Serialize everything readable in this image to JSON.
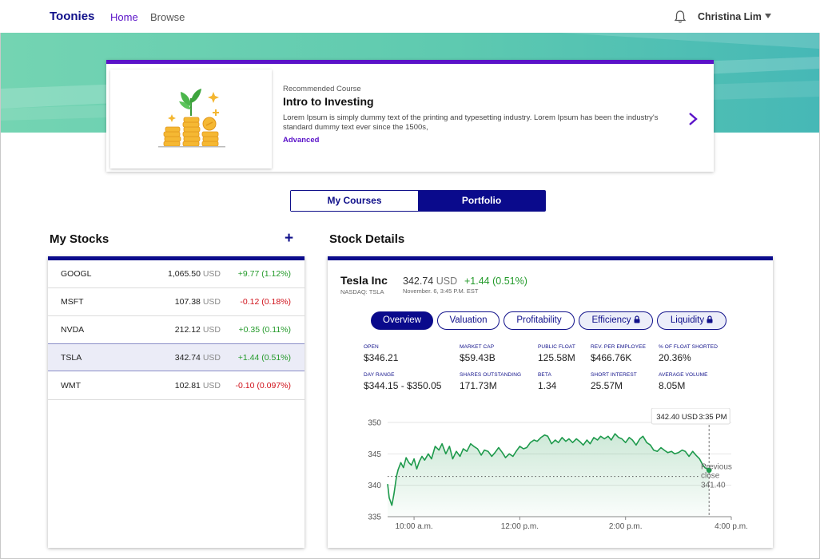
{
  "nav": {
    "brand": "Toonies",
    "home": "Home",
    "browse": "Browse",
    "user_name": "Christina Lim",
    "icons": {
      "bell": "bell-icon",
      "caret": "caret-down-icon"
    }
  },
  "course": {
    "kicker": "Recommended Course",
    "title": "Intro to Investing",
    "description": "Lorem Ipsum is simply dummy text of the printing and typesetting industry. Lorem Ipsum has been the industry's standard dummy text ever since the 1500s,",
    "level": "Advanced",
    "next_icon": "chevron-right-icon"
  },
  "toggle": {
    "my_courses": "My Courses",
    "portfolio": "Portfolio",
    "active": "Portfolio"
  },
  "my_stocks": {
    "title": "My Stocks",
    "add_label": "+",
    "rows": [
      {
        "symbol": "GOOGL",
        "price": "1,065.50",
        "unit": "USD",
        "change": "+9.77 (1.12%)",
        "direction": "up"
      },
      {
        "symbol": "MSFT",
        "price": "107.38",
        "unit": "USD",
        "change": "-0.12 (0.18%)",
        "direction": "down"
      },
      {
        "symbol": "NVDA",
        "price": "212.12",
        "unit": "USD",
        "change": "+0.35 (0.11%)",
        "direction": "up"
      },
      {
        "symbol": "TSLA",
        "price": "342.74",
        "unit": "USD",
        "change": "+1.44 (0.51%)",
        "direction": "up",
        "selected": true
      },
      {
        "symbol": "WMT",
        "price": "102.81",
        "unit": "USD",
        "change": "-0.10 (0.097%)",
        "direction": "down"
      }
    ]
  },
  "details": {
    "title": "Stock Details",
    "company": "Tesla Inc",
    "exchange": "NASDAQ: TSLA",
    "price": "342.74",
    "unit": "USD",
    "change": "+1.44 (0.51%)",
    "timestamp": "November. 6, 3:45 P.M. EST",
    "tabs": [
      {
        "label": "Overview",
        "active": true,
        "locked": false
      },
      {
        "label": "Valuation",
        "active": false,
        "locked": false
      },
      {
        "label": "Profitability",
        "active": false,
        "locked": false
      },
      {
        "label": "Efficiency",
        "active": false,
        "locked": true
      },
      {
        "label": "Liquidity",
        "active": false,
        "locked": true
      }
    ],
    "stats": {
      "open": {
        "label": "OPEN",
        "value": "$346.21"
      },
      "market_cap": {
        "label": "MARKET CAP",
        "value": "$59.43B"
      },
      "public_float": {
        "label": "PUBLIC FLOAT",
        "value": "125.58M"
      },
      "rev_per_employee": {
        "label": "REV. PER EMPLOYEE",
        "value": "$466.76K"
      },
      "pct_float_shorted": {
        "label": "% OF FLOAT SHORTED",
        "value": "20.36%"
      },
      "day_range": {
        "label": "DAY RANGE",
        "value": "$344.15 - $350.05"
      },
      "shares_outstanding": {
        "label": "SHARES OUTSTANDING",
        "value": "171.73M"
      },
      "beta": {
        "label": "BETA",
        "value": "1.34"
      },
      "short_interest": {
        "label": "SHORT INTEREST",
        "value": "25.57M"
      },
      "average_volume": {
        "label": "AVERAGE VOLUME",
        "value": "8.05M"
      }
    }
  },
  "chart_data": {
    "type": "line",
    "x_ticks": [
      "10:00 a.m.",
      "12:00 p.m.",
      "2:00 p.m.",
      "4:00 p.m."
    ],
    "y_ticks": [
      335,
      340,
      345,
      350
    ],
    "ylim": [
      335,
      350
    ],
    "xlim": [
      9.5,
      16.0
    ],
    "series": [
      {
        "x": [
          9.5,
          9.53,
          9.58,
          9.62,
          9.67,
          9.7,
          9.75,
          9.8,
          9.85,
          9.9,
          9.95,
          10.0,
          10.05,
          10.1,
          10.15,
          10.2,
          10.27,
          10.33,
          10.4,
          10.47,
          10.53,
          10.6,
          10.67,
          10.73,
          10.8,
          10.87,
          10.93,
          11.0,
          11.07,
          11.13,
          11.2,
          11.27,
          11.33,
          11.4,
          11.47,
          11.53,
          11.6,
          11.67,
          11.73,
          11.8,
          11.87,
          11.93,
          12.0,
          12.07,
          12.13,
          12.2,
          12.27,
          12.33,
          12.4,
          12.47,
          12.53,
          12.6,
          12.67,
          12.73,
          12.8,
          12.87,
          12.93,
          13.0,
          13.07,
          13.13,
          13.2,
          13.27,
          13.33,
          13.4,
          13.47,
          13.53,
          13.6,
          13.67,
          13.73,
          13.8,
          13.87,
          13.93,
          14.0,
          14.07,
          14.13,
          14.2,
          14.27,
          14.33,
          14.4,
          14.47,
          14.53,
          14.6,
          14.67,
          14.73,
          14.8,
          14.87,
          14.93,
          15.0,
          15.07,
          15.13,
          15.2,
          15.27,
          15.33,
          15.4,
          15.45,
          15.5,
          15.58
        ],
        "y": [
          340.2,
          338.0,
          336.8,
          338.6,
          341.5,
          342.5,
          343.6,
          342.8,
          344.4,
          343.6,
          343.2,
          344.2,
          342.6,
          343.8,
          344.6,
          344.0,
          345.0,
          344.2,
          346.2,
          345.6,
          346.6,
          345.0,
          346.2,
          344.2,
          345.4,
          344.6,
          345.8,
          345.4,
          346.6,
          346.2,
          345.8,
          344.8,
          345.6,
          345.4,
          344.6,
          345.2,
          346.0,
          345.2,
          344.4,
          345.0,
          344.6,
          345.4,
          346.2,
          345.8,
          346.0,
          346.8,
          347.2,
          347.0,
          347.6,
          348.0,
          347.8,
          346.6,
          347.2,
          346.8,
          347.6,
          347.0,
          347.4,
          346.8,
          347.4,
          347.0,
          346.4,
          347.2,
          346.6,
          347.6,
          347.2,
          347.8,
          347.4,
          347.8,
          347.2,
          348.2,
          347.6,
          347.4,
          346.8,
          347.6,
          347.2,
          346.4,
          347.4,
          347.8,
          346.8,
          346.4,
          345.6,
          345.4,
          346.0,
          345.6,
          345.2,
          345.4,
          345.0,
          345.2,
          345.6,
          345.4,
          344.6,
          345.4,
          344.8,
          344.2,
          343.4,
          342.8,
          342.4
        ]
      }
    ],
    "previous_close": 341.4,
    "previous_close_label": "Previous close",
    "previous_close_value": "341.40",
    "tooltip": {
      "price": "342.40 USD",
      "time": "3:35 PM",
      "x": 15.58
    },
    "grid": true,
    "line_color": "#1e9a4c"
  },
  "colors": {
    "brand_navy": "#0a0a8c",
    "accent_purple": "#5a12c8",
    "positive": "#239a2a",
    "negative": "#d0121b",
    "hero_teal": "#4fc0ad"
  }
}
